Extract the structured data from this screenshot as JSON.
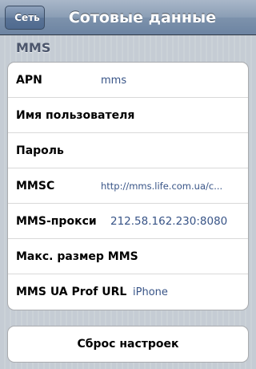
{
  "navbar": {
    "back_label": "Сеть",
    "title": "Сотовые данные"
  },
  "section": {
    "header": "MMS"
  },
  "fields": {
    "apn": {
      "label": "APN",
      "value": "mms"
    },
    "username": {
      "label": "Имя пользователя",
      "value": ""
    },
    "password": {
      "label": "Пароль",
      "value": ""
    },
    "mmsc": {
      "label": "MMSC",
      "value": "http://mms.life.com.ua/c..."
    },
    "proxy": {
      "label": "MMS-прокси",
      "value": "212.58.162.230:8080"
    },
    "max_size": {
      "label": "Макс. размер MMS",
      "value": ""
    },
    "ua_prof": {
      "label": "MMS UA Prof URL",
      "value": "iPhone"
    }
  },
  "reset": {
    "label": "Сброс настроек"
  }
}
